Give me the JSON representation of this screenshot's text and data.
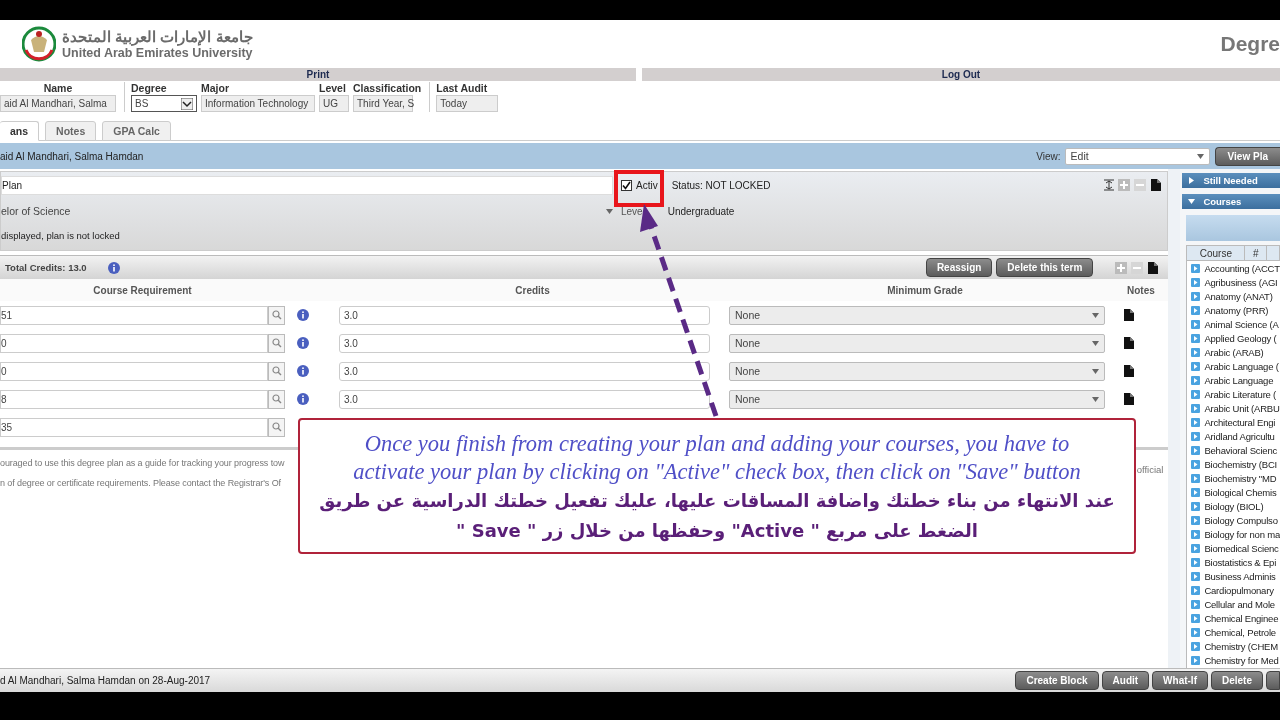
{
  "header": {
    "university_arabic": "جامعة الإمارات العربية المتحدة",
    "university_english": "United Arab Emirates University",
    "app_title": "Degre"
  },
  "nav": [
    "Print",
    "Log Out"
  ],
  "student_fields": [
    {
      "label": "Name",
      "value": "aid Al Mandhari, Salma",
      "kind": "text"
    },
    {
      "label": "Degree",
      "value": "BS",
      "kind": "select"
    },
    {
      "label": "Major",
      "value": "Information Technology",
      "kind": "text"
    },
    {
      "label": "Level",
      "value": "UG",
      "kind": "text"
    },
    {
      "label": "Classification",
      "value": "Third Year, S",
      "kind": "text"
    },
    {
      "label": "Last Audit",
      "value": "Today",
      "kind": "text"
    }
  ],
  "tabs": [
    {
      "label": "ans",
      "selected": true
    },
    {
      "label": "Notes",
      "selected": false
    },
    {
      "label": "GPA Calc",
      "selected": false
    }
  ],
  "student_bar": {
    "name": "aid Al Mandhari, Salma Hamdan",
    "view_label": "View:",
    "view_value": "Edit",
    "view_button": "View Pla"
  },
  "plan": {
    "description": "Plan",
    "active_label": "Activ",
    "active": true,
    "status": "Status: NOT LOCKED",
    "degree": "elor of Science",
    "level_label": "Leve",
    "level": "Undergraduate",
    "message": "displayed, plan is not locked"
  },
  "term": {
    "total_credits": "Total Credits: 13.0",
    "buttons": [
      "Reassign",
      "Delete this term"
    ]
  },
  "table": {
    "columns": [
      "Course Requirement",
      "Credits",
      "Minimum Grade",
      "Notes"
    ],
    "rows": [
      {
        "course": "51",
        "credits": "3.0",
        "grade": "None"
      },
      {
        "course": "0",
        "credits": "3.0",
        "grade": "None"
      },
      {
        "course": "0",
        "credits": "3.0",
        "grade": "None"
      },
      {
        "course": "8",
        "credits": "3.0",
        "grade": "None"
      },
      {
        "course": "35"
      }
    ]
  },
  "disclaimer": [
    "ouraged to use this degree plan as a guide for tracking your progress tow",
    "n of degree or certificate requirements. Please contact the Registrar's Of"
  ],
  "disclaimer_right": "official",
  "side_panel": {
    "sections": [
      {
        "label": "Still Needed",
        "expanded": false
      },
      {
        "label": "Courses",
        "expanded": true
      }
    ],
    "columns": [
      "Course",
      "#"
    ],
    "courses": [
      "Accounting (ACCT",
      "Agribusiness (AGI",
      "Anatomy (ANAT)",
      "Anatomy (PRR)",
      "Animal Science (A",
      "Applied Geology (",
      "Arabic (ARAB)",
      "Arabic Language (",
      "Arabic Language",
      "Arabic Literature (",
      "Arabic Unit (ARBU",
      "Architectural Engi",
      "Aridland Agricultu",
      "Behavioral Scienc",
      "Biochemistry (BCI",
      "Biochemistry \"MD",
      "Biological Chemis",
      "Biology (BIOL)",
      "Biology Compulso",
      "Biology for non ma",
      "Biomedical Scienc",
      "Biostatistics & Epi",
      "Business Adminis",
      "Cardiopulmonary",
      "Cellular and Mole",
      "Chemical Enginee",
      "Chemical, Petrole",
      "Chemistry (CHEM",
      "Chemistry for Med"
    ]
  },
  "footer": {
    "text": "d Al Mandhari, Salma Hamdan on 28-Aug-2017",
    "buttons": [
      "Create Block",
      "Audit",
      "What-If",
      "Delete"
    ]
  },
  "callout": {
    "english": [
      "Once you finish from creating your plan and adding your courses, you have to",
      "activate your plan by clicking on \"Active\" check box, then click on \"Save\" button"
    ],
    "arabic": [
      "عند الانتهاء من بناء خطتك واضافة المساقات عليها، عليك تفعيل خطتك الدراسية عن طريق",
      "الضغط على مربع \" Active\" وحفظها من خلال زر  \" Save \""
    ]
  }
}
